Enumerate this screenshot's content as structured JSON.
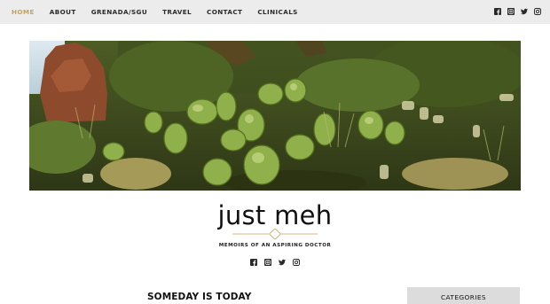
{
  "nav": {
    "items": [
      {
        "label": "HOME",
        "active": true
      },
      {
        "label": "ABOUT",
        "active": false
      },
      {
        "label": "GRENADA/SGU",
        "active": false
      },
      {
        "label": "TRAVEL",
        "active": false
      },
      {
        "label": "CONTACT",
        "active": false
      },
      {
        "label": "CLINICALS",
        "active": false
      }
    ],
    "social_icons": [
      "facebook-icon",
      "instagram-icon",
      "twitter-icon",
      "instagram-icon"
    ]
  },
  "site": {
    "title": "just meh",
    "tagline": "MEMOIRS OF AN ASPIRING DOCTOR",
    "social_icons": [
      "facebook-icon",
      "instagram-icon",
      "twitter-icon",
      "instagram-icon"
    ]
  },
  "post": {
    "title": "SOMEDAY IS TODAY"
  },
  "sidebar": {
    "categories_label": "CATEGORIES"
  },
  "colors": {
    "accent": "#c6a25a",
    "topbar_bg": "#ececec",
    "sidebar_box_bg": "#dcdcdc"
  }
}
